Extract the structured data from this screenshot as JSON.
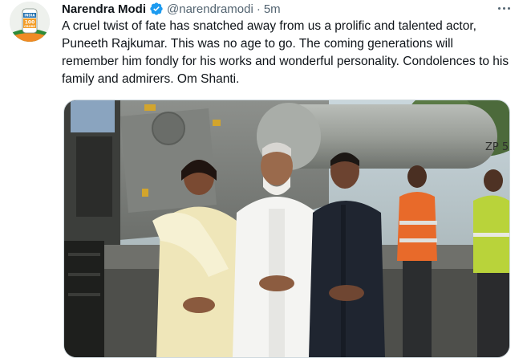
{
  "tweet": {
    "author_name": "Narendra Modi",
    "handle": "@narendramodi",
    "separator": "·",
    "time": "5m",
    "text": "A cruel twist of fate has snatched away from us a prolific and talented actor, Puneeth Rajkumar. This was no age to go. The coming generations will remember him fondly for his works and wonderful personality. Condolences to his family and admirers. Om Shanti.",
    "verified": true,
    "avatar": {
      "badge_top": "INDIA",
      "badge_main": "100",
      "badge_bottom": "CRORE"
    }
  },
  "colors": {
    "verified_blue": "#1d9bf0",
    "text_primary": "#0f1419",
    "text_secondary": "#536471"
  },
  "icons": {
    "verified": "verified-badge-icon",
    "more": "more-options-icon"
  }
}
